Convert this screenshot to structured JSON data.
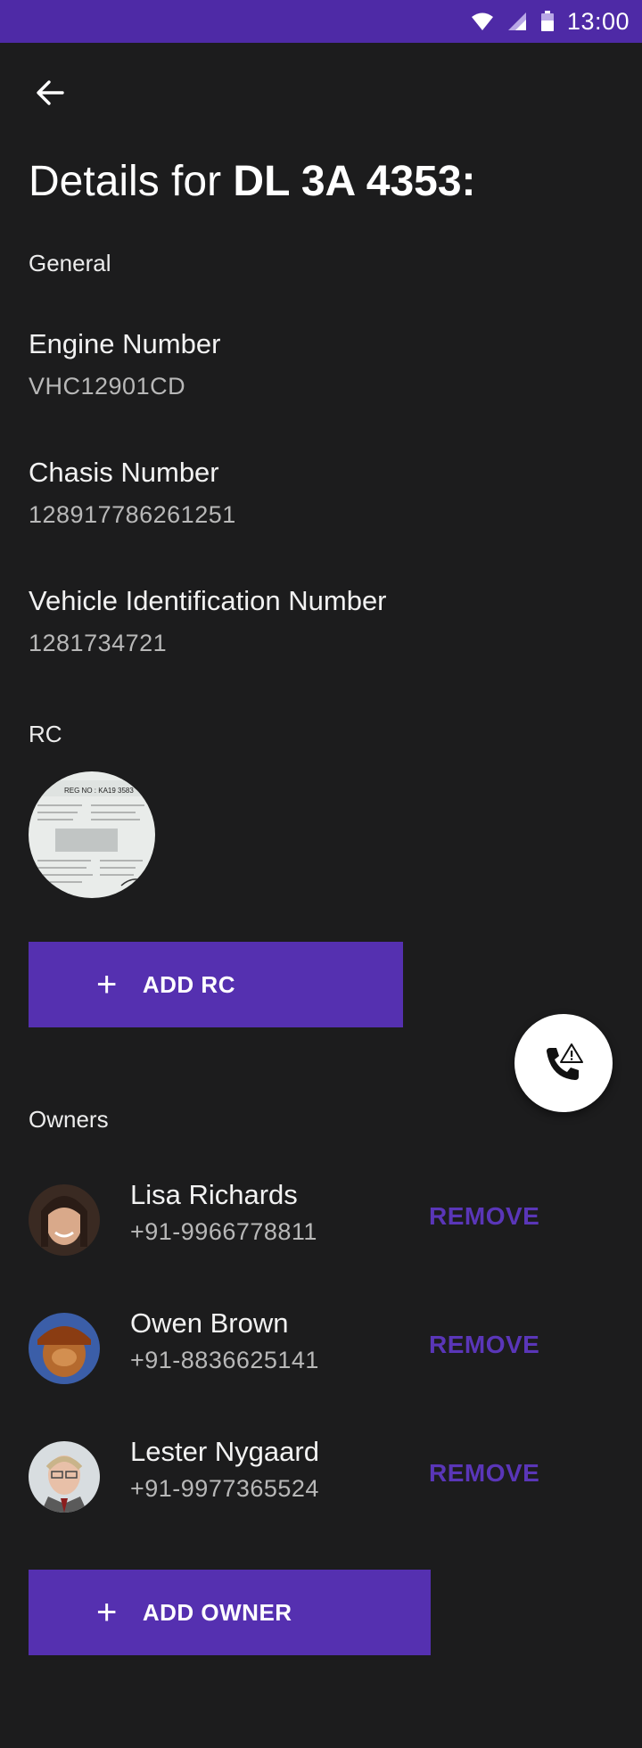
{
  "status_bar": {
    "time": "13:00"
  },
  "header": {
    "back_icon": "arrow-back-icon",
    "title_prefix": "Details for ",
    "title_plate": "DL 3A 4353:"
  },
  "general": {
    "section_label": "General",
    "fields": [
      {
        "label": "Engine Number",
        "value": "VHC12901CD"
      },
      {
        "label": "Chasis Number",
        "value": "128917786261251"
      },
      {
        "label": "Vehicle Identification Number",
        "value": "1281734721"
      }
    ]
  },
  "rc": {
    "section_label": "RC",
    "thumbnail_text": "REG NO : KA19 3583",
    "add_button_label": "ADD RC"
  },
  "fab": {
    "icon": "phone-alert-icon"
  },
  "owners": {
    "section_label": "Owners",
    "items": [
      {
        "name": "Lisa Richards",
        "phone": "+91-9966778811",
        "action": "REMOVE"
      },
      {
        "name": "Owen Brown",
        "phone": "+91-8836625141",
        "action": "REMOVE"
      },
      {
        "name": "Lester Nygaard",
        "phone": "+91-9977365524",
        "action": "REMOVE"
      }
    ],
    "add_button_label": "ADD OWNER"
  },
  "colors": {
    "accent": "#5530b0",
    "status_bar": "#4e2aa6",
    "background": "#1c1c1d",
    "remove_text": "#5a36b8"
  }
}
